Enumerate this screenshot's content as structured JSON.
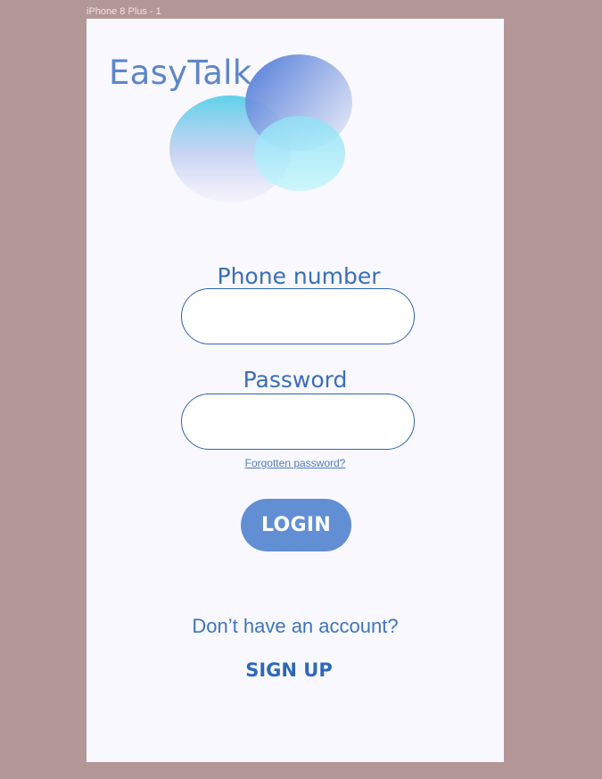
{
  "frame": {
    "label": "iPhone 8 Plus - 1"
  },
  "app": {
    "title": "EasyTalk"
  },
  "form": {
    "phone_label": "Phone number",
    "phone_value": "",
    "password_label": "Password",
    "password_value": "",
    "forgot_password": "Forgotten password?",
    "login_label": "LOGIN"
  },
  "footer": {
    "no_account_text": "Don’t have an account?",
    "signup_label": "SIGN UP"
  },
  "colors": {
    "background": "#b39696",
    "screen": "#f9f8fe",
    "accent": "#5d86c8",
    "button": "#628fd3",
    "label": "#3a6fb8"
  },
  "icons": {
    "logo": "speech-bubbles-logo"
  }
}
